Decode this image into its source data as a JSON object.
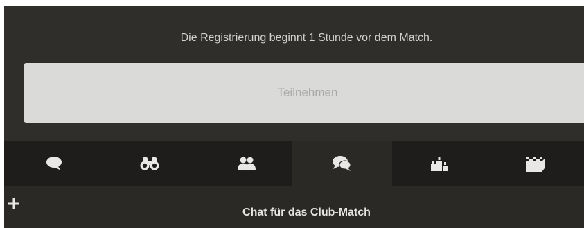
{
  "registration": {
    "notice": "Die Registrierung beginnt 1 Stunde vor dem Match.",
    "join_label": "Teilnehmen"
  },
  "tabs": [
    {
      "icon": "speech-bubble-icon",
      "active": false
    },
    {
      "icon": "binoculars-icon",
      "active": false
    },
    {
      "icon": "users-icon",
      "active": false
    },
    {
      "icon": "chat-bubbles-icon",
      "active": true
    },
    {
      "icon": "podium-icon",
      "active": false
    },
    {
      "icon": "checkered-flag-box-icon",
      "active": false
    }
  ],
  "chat": {
    "add_icon": "plus-icon",
    "title": "Chat für das Club-Match"
  },
  "colors": {
    "panel_bg": "#302e2b",
    "tabbar_bg": "#1e1d1b",
    "active_tab_bg": "#2b2926",
    "icon": "#e8e7e5",
    "button_bg": "#dadad9",
    "button_text": "#a8a8a7"
  }
}
